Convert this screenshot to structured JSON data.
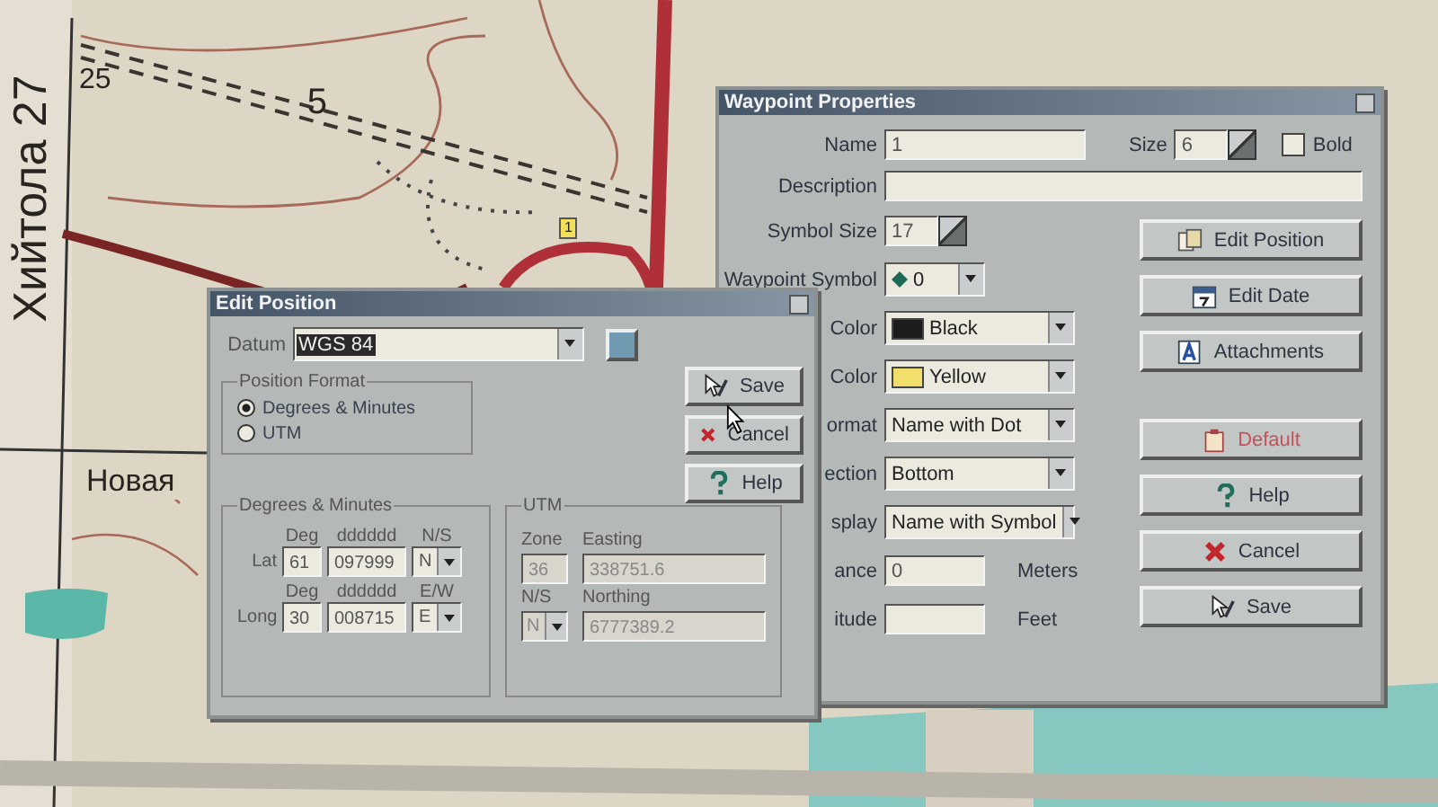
{
  "map": {
    "labels": [
      {
        "kind": "vertical",
        "text": "Хийтола 27"
      },
      {
        "kind": "place",
        "text": "Новая"
      },
      {
        "kind": "contour",
        "text": "5"
      },
      {
        "kind": "contour",
        "text": "25"
      }
    ],
    "waypoint_marker": "1"
  },
  "waypoint_properties": {
    "title": "Waypoint Properties",
    "name": {
      "label": "Name",
      "value": "1"
    },
    "size": {
      "label": "Size",
      "value": "6"
    },
    "bold": {
      "label": "Bold",
      "checked": false
    },
    "description": {
      "label": "Description"
    },
    "symbol_size": {
      "label": "Symbol Size",
      "value": "17"
    },
    "waypoint_symbol": {
      "label": "Waypoint Symbol",
      "value": "0"
    },
    "rows": [
      {
        "label": "Color",
        "kind": "color",
        "value": "Black",
        "color": "#1c1c1c"
      },
      {
        "label": "Color",
        "kind": "color",
        "value": "Yellow",
        "color": "#f2de6a"
      },
      {
        "label": "ormat",
        "kind": "dropdown",
        "value": "Name with Dot"
      },
      {
        "label": "ection",
        "kind": "dropdown",
        "value": "Bottom"
      },
      {
        "label": "splay",
        "kind": "dropdown",
        "value": "Name with Symbol"
      },
      {
        "label": "ance",
        "kind": "number",
        "value": "0",
        "unit": "Meters"
      },
      {
        "label": "itude",
        "kind": "number",
        "unit": "Feet"
      }
    ],
    "buttons": [
      {
        "label": "Edit Position",
        "kind": "edit-position"
      },
      {
        "label": "Edit Date",
        "kind": "edit-date"
      },
      {
        "label": "Attachments",
        "kind": "attachments"
      },
      {
        "label": "Default",
        "kind": "default"
      },
      {
        "label": "Help",
        "kind": "help"
      },
      {
        "label": "Cancel",
        "kind": "cancel"
      },
      {
        "label": "Save",
        "kind": "save"
      }
    ]
  },
  "edit_position": {
    "title": "Edit Position",
    "datum": {
      "label": "Datum",
      "value": "WGS 84"
    },
    "buttons": [
      {
        "label": "Save",
        "kind": "save"
      },
      {
        "label": "Cancel",
        "kind": "cancel"
      },
      {
        "label": "Help",
        "kind": "help"
      }
    ],
    "position_format": {
      "title": "Position Format",
      "options": [
        {
          "label": "Degrees & Minutes",
          "selected": true
        },
        {
          "label": "UTM",
          "selected": false
        }
      ]
    },
    "degrees_minutes": {
      "title": "Degrees & Minutes",
      "rows": [
        {
          "label": "Lat",
          "deg_heading": "Deg",
          "deg": "61",
          "min_heading": "dddddd",
          "min": "097999",
          "hem_heading": "N/S",
          "hem": "N"
        },
        {
          "label": "Long",
          "deg_heading": "Deg",
          "deg": "30",
          "min_heading": "dddddd",
          "min": "008715",
          "hem_heading": "E/W",
          "hem": "E"
        }
      ]
    },
    "utm": {
      "title": "UTM",
      "disabled": true,
      "zone_label": "Zone",
      "zone": "36",
      "easting_label": "Easting",
      "easting": "338751.6",
      "ns_label": "N/S",
      "ns": "N",
      "northing_label": "Northing",
      "northing": "6777389.2"
    }
  }
}
